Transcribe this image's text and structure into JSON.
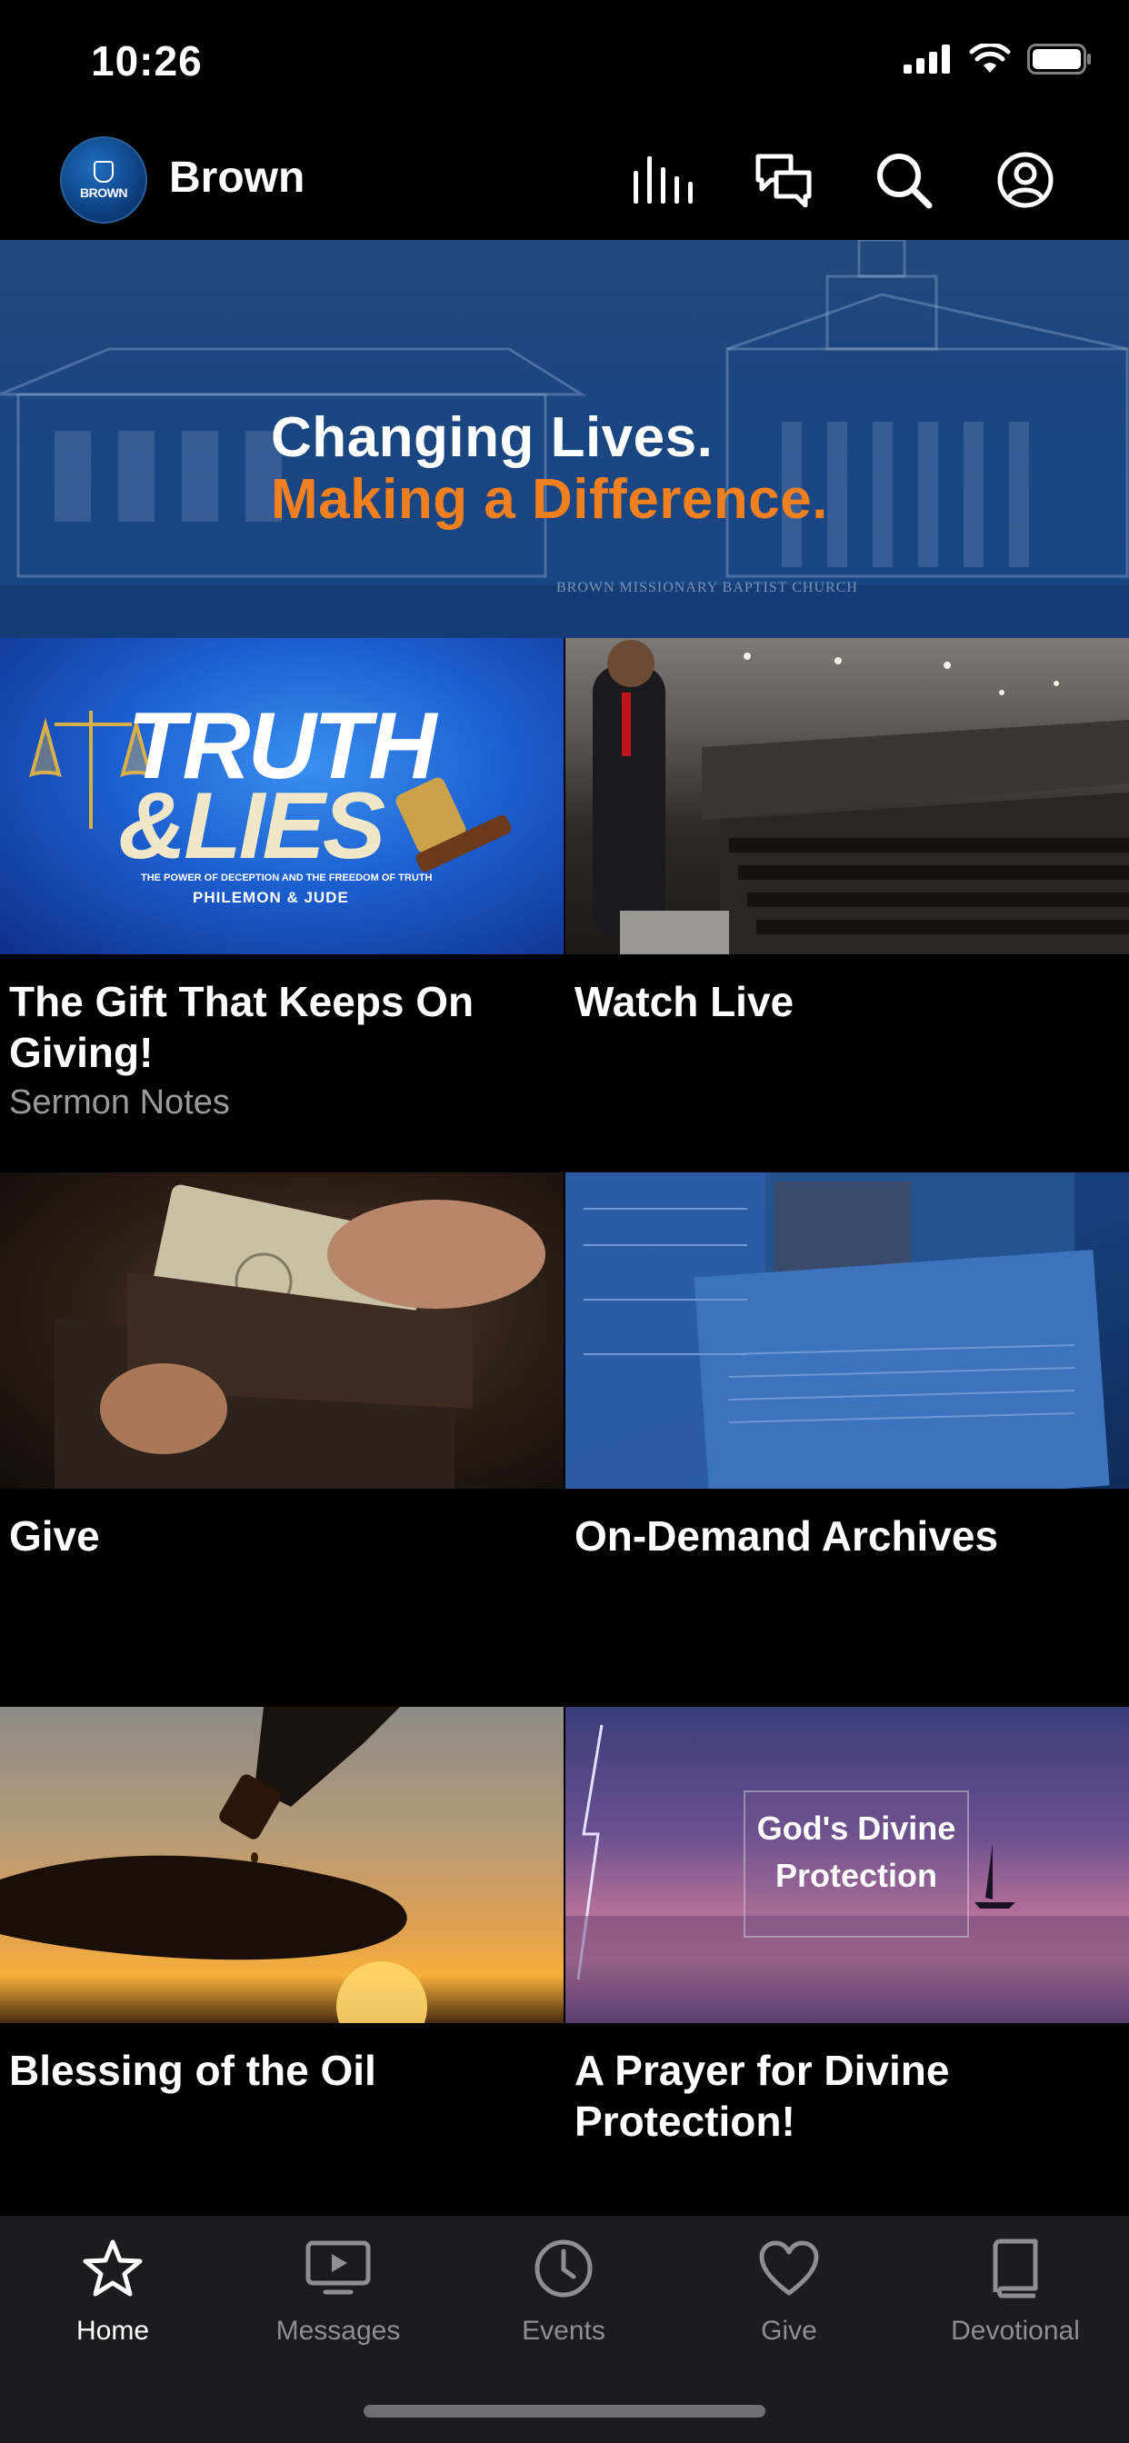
{
  "status_bar": {
    "time": "10:26"
  },
  "header": {
    "title": "Brown",
    "logo_text": "BROWN"
  },
  "hero": {
    "line1": "Changing Lives.",
    "line2": "Making a Difference.",
    "caption": "BROWN MISSIONARY BAPTIST CHURCH",
    "accent_color": "#f0801f"
  },
  "tiles": [
    {
      "title": "The Gift That Keeps On Giving!",
      "subtitle": "Sermon Notes",
      "art": {
        "word1": "TRUTH",
        "word2": "&LIES",
        "sub1": "THE POWER OF DECEPTION AND THE FREEDOM OF TRUTH",
        "sub2": "PHILEMON & JUDE"
      }
    },
    {
      "title": "Watch Live"
    },
    {
      "title": "Give"
    },
    {
      "title": "On-Demand Archives"
    },
    {
      "title": "Blessing of the Oil"
    },
    {
      "title": "A Prayer for Divine Protection!",
      "art_text": "God's Divine Protection"
    }
  ],
  "tab_bar": {
    "items": [
      {
        "label": "Home",
        "icon": "star-icon",
        "active": true
      },
      {
        "label": "Messages",
        "icon": "play-screen-icon"
      },
      {
        "label": "Events",
        "icon": "clock-icon"
      },
      {
        "label": "Give",
        "icon": "heart-icon"
      },
      {
        "label": "Devotional",
        "icon": "book-icon"
      }
    ]
  }
}
